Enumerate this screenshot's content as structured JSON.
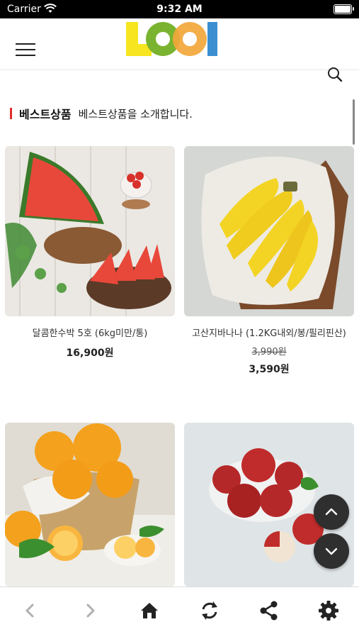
{
  "status": {
    "carrier": "Carrier",
    "time": "9:32 AM"
  },
  "header": {
    "logo_text": "LOOI"
  },
  "section": {
    "title": "베스트상품",
    "subtitle": "베스트상품을 소개합니다."
  },
  "products": [
    {
      "name": "달콤한수박 5호 (6kg미만/통)",
      "price": "16,900원"
    },
    {
      "name": "고산지바나나 (1.2KG내외/봉/필리핀산)",
      "original_price": "3,990원",
      "price": "3,590원"
    },
    {
      "name": "",
      "price": ""
    },
    {
      "name": "",
      "price": ""
    }
  ],
  "colors": {
    "accent": "#e52b2b",
    "fab": "#2f2f2f"
  },
  "bottom_nav": [
    "back-icon",
    "forward-icon",
    "home-icon",
    "refresh-icon",
    "share-icon",
    "settings-icon"
  ]
}
